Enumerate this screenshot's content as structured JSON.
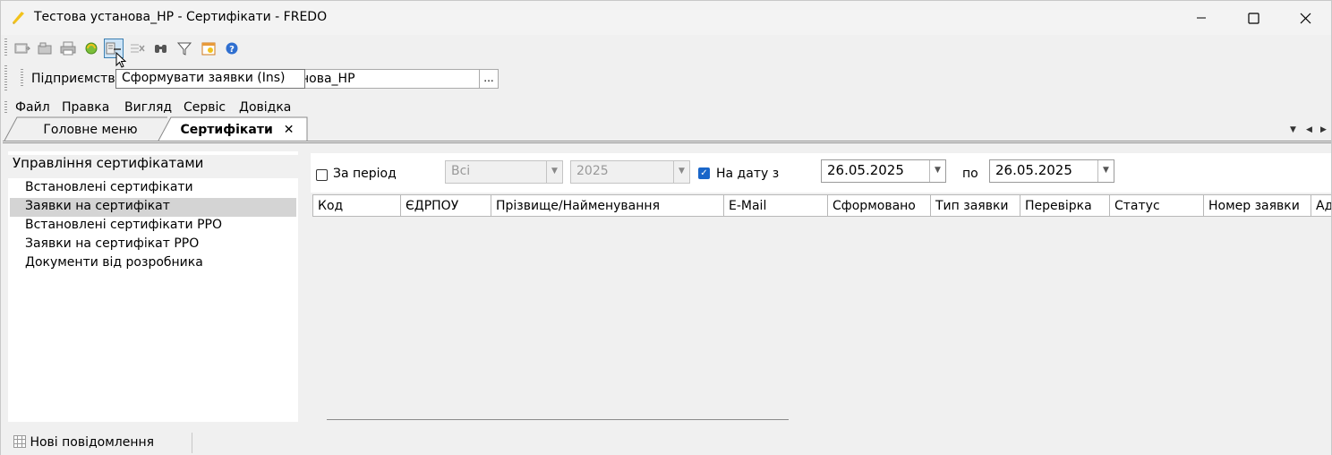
{
  "window": {
    "title": "Тестова установа_НР - Сертифікати - FREDO",
    "minimize_icon": "minimize-icon",
    "maximize_icon": "maximize-icon",
    "close_icon": "close-icon"
  },
  "toolbar": {
    "buttons": [
      "open-icon",
      "archive-icon",
      "print-icon",
      "refresh-icon",
      "create-requests-icon",
      "delete-icon",
      "find-icon",
      "filter-icon",
      "calendar-icon",
      "help-icon"
    ],
    "tooltip": "Сформувати заявки (Ins)"
  },
  "enterprise": {
    "label": "Підприємство",
    "value": "Тестова установа_НР",
    "visible_value": "нова_НР",
    "browse_label": "..."
  },
  "menu": [
    "Файл",
    "Правка",
    "Вигляд",
    "Сервіс",
    "Довідка"
  ],
  "tabs": [
    {
      "label": "Головне меню"
    },
    {
      "label": "Сертифікати",
      "close": "✕"
    }
  ],
  "left": {
    "title": "Управління сертифікатами",
    "items": [
      "Встановлені сертифікати",
      "Заявки на сертифікат",
      "Встановлені сертифікати РРО",
      "Заявки на сертифікат РРО",
      "Документи від розробника"
    ],
    "selected_index": 1
  },
  "filter": {
    "period_label": "За період",
    "period_checked": false,
    "period_value": "Всі",
    "year_value": "2025",
    "date_label": "На дату з",
    "date_checked": true,
    "date_from": "26.05.2025",
    "to_label": "по",
    "date_to": "26.05.2025"
  },
  "table": {
    "columns": [
      "Код",
      "ЄДРПОУ",
      "Прізвище/Найменування",
      "E-Mail",
      "Сформовано",
      "Тип заявки",
      "Перевірка",
      "Статус",
      "Номер заявки",
      "Ад"
    ],
    "rows": []
  },
  "status": {
    "messages": "Нові повідомлення"
  }
}
